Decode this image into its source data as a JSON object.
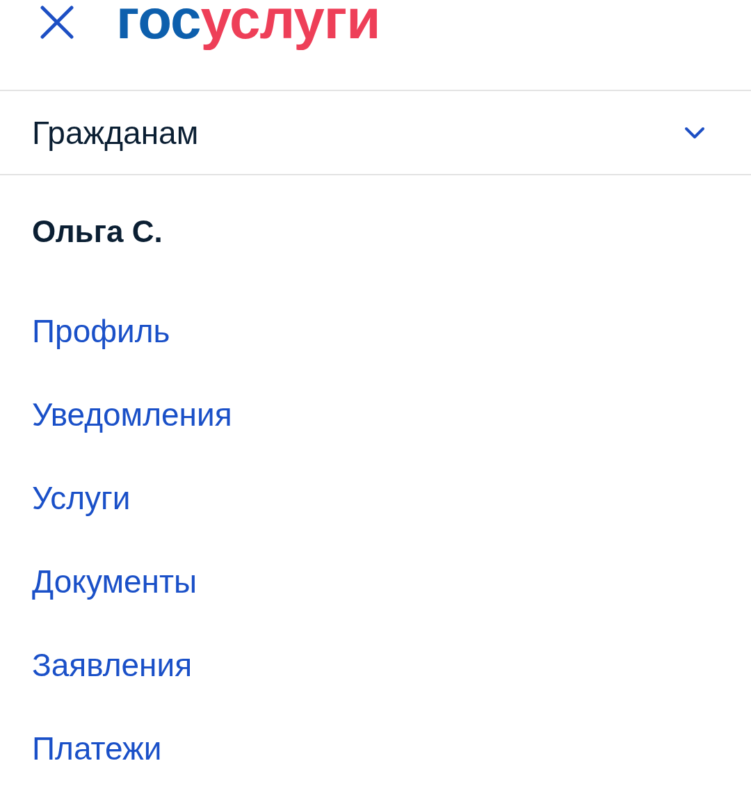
{
  "logo": {
    "parts": [
      "гос",
      "услуги"
    ]
  },
  "audience_selector": {
    "label": "Гражданам",
    "expanded": false
  },
  "user": {
    "name": "Ольга С."
  },
  "menu": [
    "Профиль",
    "Уведомления",
    "Услуги",
    "Документы",
    "Заявления",
    "Платежи"
  ]
}
